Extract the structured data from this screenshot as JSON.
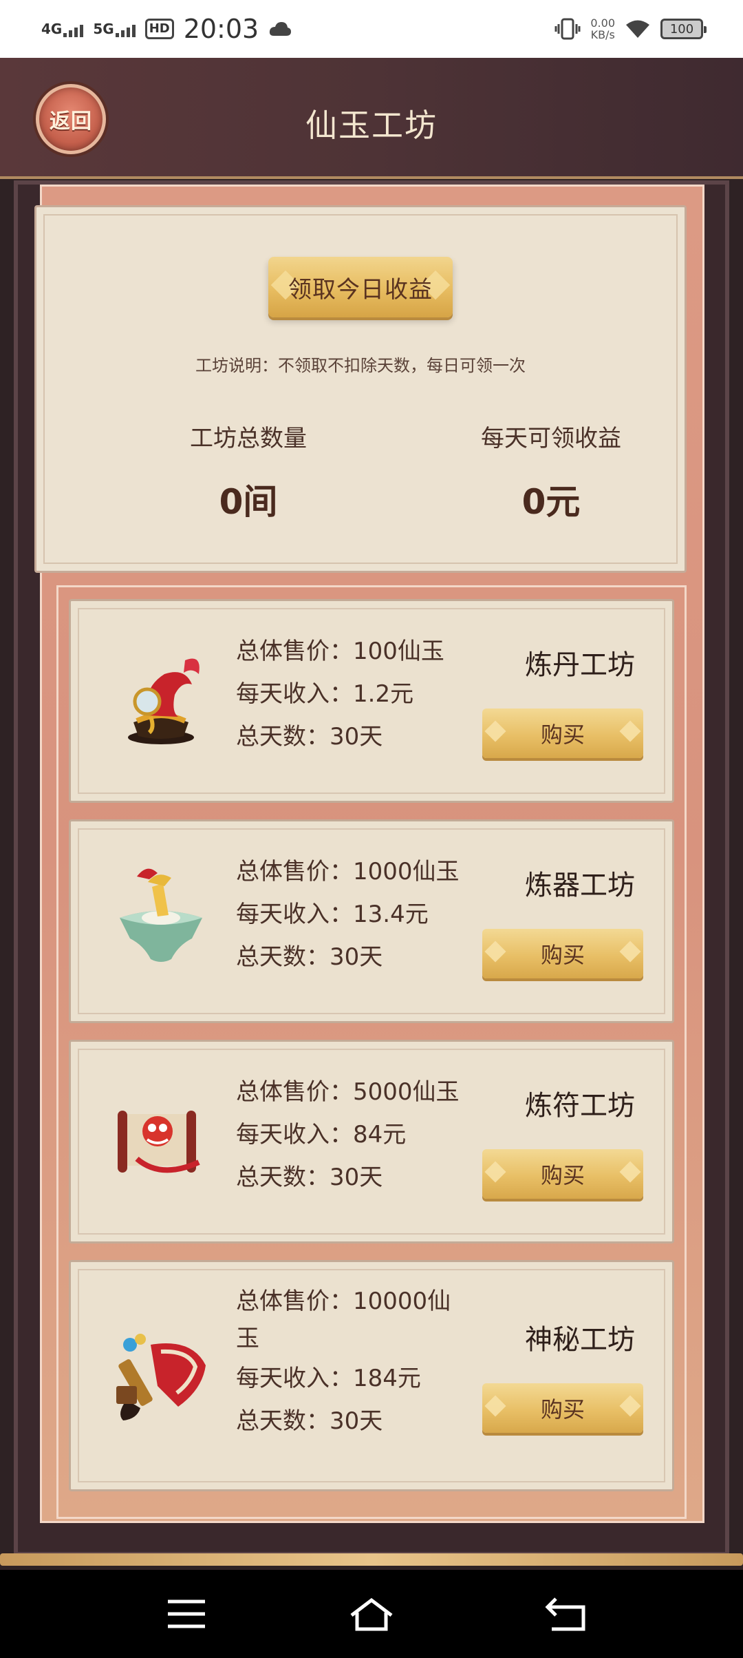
{
  "status_bar": {
    "network1": "4G",
    "network2": "5G",
    "hd": "HD",
    "time": "20:03",
    "speed_value": "0.00",
    "speed_unit": "KB/s",
    "battery": "100"
  },
  "header": {
    "back_label": "返回",
    "title": "仙玉工坊"
  },
  "summary": {
    "collect_button": "领取今日收益",
    "note": "工坊说明：不领取不扣除天数，每日可领一次",
    "total_label": "工坊总数量",
    "total_value": "0间",
    "daily_label": "每天可领收益",
    "daily_value": "0元"
  },
  "workshops": [
    {
      "name": "炼丹工坊",
      "price": "总体售价：100仙玉",
      "income": "每天收入：1.2元",
      "days": "总天数：30天",
      "buy": "购买",
      "icon": "alchemy-furnace-icon"
    },
    {
      "name": "炼器工坊",
      "price": "总体售价：1000仙玉",
      "income": "每天收入：13.4元",
      "days": "总天数：30天",
      "buy": "购买",
      "icon": "forge-anvil-icon"
    },
    {
      "name": "炼符工坊",
      "price": "总体售价：5000仙玉",
      "income": "每天收入：84元",
      "days": "总天数：30天",
      "buy": "购买",
      "icon": "talisman-scroll-icon"
    },
    {
      "name": "神秘工坊",
      "price_line1": "总体售价：10000仙",
      "price_line2": "玉",
      "income": "每天收入：184元",
      "days": "总天数：30天",
      "buy": "购买",
      "icon": "mystic-brush-scroll-icon"
    }
  ],
  "colors": {
    "header_bg": "#4e3336",
    "panel_bg": "#d8937e",
    "card_bg": "#ebe1cf",
    "button_gold": "#e8bf66",
    "text_dark": "#4a3128"
  },
  "nav_bar": {
    "icons": [
      "menu-icon",
      "home-icon",
      "back-icon"
    ]
  }
}
